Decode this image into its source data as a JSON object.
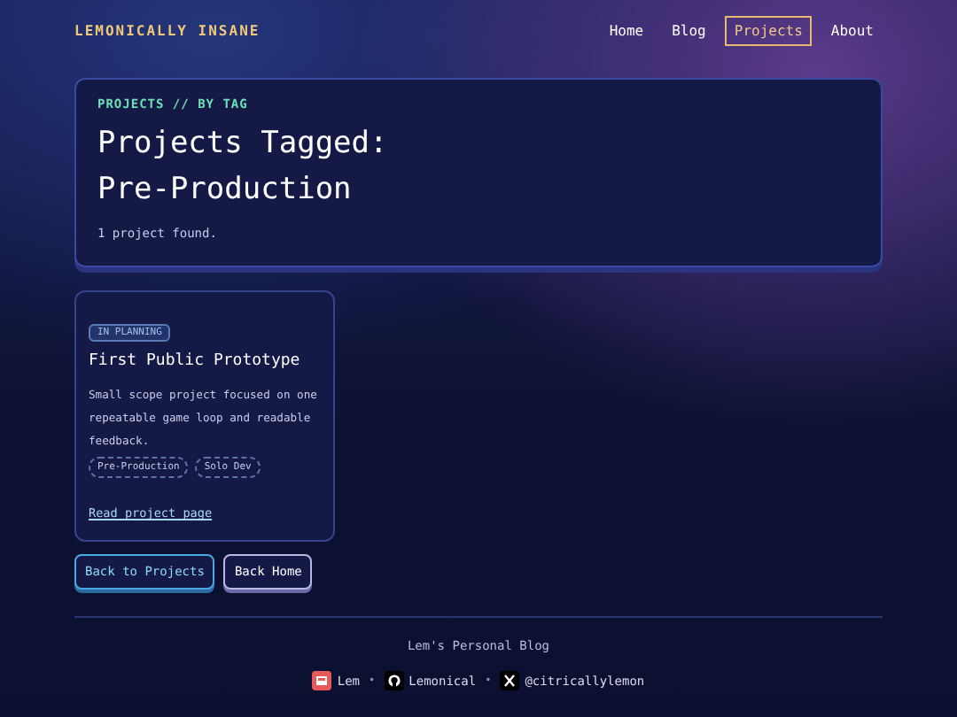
{
  "site": {
    "logo": "LEMONICALLY INSANE"
  },
  "nav": [
    {
      "label": "Home",
      "selected": false
    },
    {
      "label": "Blog",
      "selected": false
    },
    {
      "label": "Projects",
      "selected": true
    },
    {
      "label": "About",
      "selected": false
    }
  ],
  "hero": {
    "eyebrow": "PROJECTS // BY TAG",
    "title_lines": [
      "Projects Tagged:",
      "Pre-Production"
    ],
    "count": "1 project found."
  },
  "projects": [
    {
      "status": "IN PLANNING",
      "title": "First Public Prototype",
      "description": "Small scope project focused on one repeatable game loop and readable feedback.",
      "tags": [
        "Pre-Production",
        "Solo Dev"
      ],
      "link": "Read project page"
    }
  ],
  "buttons": [
    {
      "label": "Back to Projects",
      "kind": "primary"
    },
    {
      "label": "Back Home",
      "kind": "secondary"
    }
  ],
  "footer": {
    "title": "Lem's Personal Blog",
    "separator": "•",
    "links": [
      {
        "label": "Lem",
        "kind": "kofi"
      },
      {
        "label": "Lemonical",
        "kind": "github"
      },
      {
        "label": "@citricallylemon",
        "kind": "x"
      }
    ]
  }
}
